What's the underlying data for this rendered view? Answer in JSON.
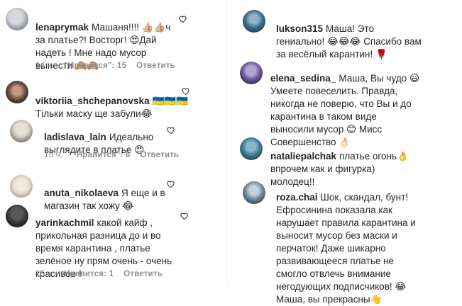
{
  "left": [
    {
      "username": "lenaprymak",
      "text": "Машаня!!!! 👍🏼👍🏼ч\nза платье?! Восторг! 😍Дай\nнадеть ! Мне надо мусор\nвынести 🙈🙈",
      "time": "14 ч.",
      "likes": "\"Нравится\": 15",
      "reply": "Ответить",
      "avatar_colors": [
        "#d8d8dc",
        "#8a8f99"
      ]
    },
    {
      "username": "viktoriia_shchepanovska",
      "text": "🇺🇦🇺🇦🇺🇦\nТільки маску ще забули😂",
      "time": "",
      "likes": "",
      "reply": "",
      "avatar_colors": [
        "#7b5a4a",
        "#2f2420"
      ]
    },
    {
      "username": "ladislava_lain",
      "text": "Идеально\nвыглядите в платье 😍",
      "time": "15 ч.",
      "likes": "\"Нравится\": 6",
      "reply": "Ответить",
      "avatar_colors": [
        "#c9c2b5",
        "#6f6a62"
      ]
    },
    {
      "username": "anuta_nikolaeva",
      "text": "Я еще и в\nмагазин так хожу 😂",
      "time": "",
      "likes": "",
      "reply": "",
      "avatar_colors": [
        "#e6d9cf",
        "#a58f80"
      ]
    },
    {
      "username": "yarinkachmil",
      "text": "какой кайф ,\nприкольная разница до и во\nвремя карантина , платье\nзелёное ну прям очень - очень\nкрасивое !",
      "time": "15 ч.",
      "likes": "Нравится: 1",
      "reply": "Ответить",
      "avatar_colors": [
        "#3a3a3a",
        "#111111"
      ]
    }
  ],
  "right": [
    {
      "username": "lukson315",
      "text": "Маша! Это\nгениально! 😂😂😂 Спасибо вам\nза весёлый карантин! 🌹",
      "avatar_colors": [
        "#3b6b88",
        "#1e3c52"
      ]
    },
    {
      "username": "elena_sedina_",
      "text": "Маша, Вы чудо 😃\nУмеете повеселить. Правда,\nникогда не поверю, что Вы и до\nкарантина в таком виде\nвыносили мусор 😊 Мисс\nСовершенство 👌🏻",
      "avatar_colors": [
        "#6b5a9a",
        "#2c2540"
      ]
    },
    {
      "username": "nataliepalchak",
      "text": "платье огонь👌\nвпрочем как и фигурка)\nмолодец!!",
      "avatar_colors": [
        "#3e7a8f",
        "#1f3a45"
      ]
    },
    {
      "username": "roza.chai",
      "text": "Шок, скандал, бунт!\nЕфросинина показала как\nнарушает правила карантина и\nвыносит мусор без маски и\nперчаток! Даже шикарно\nразвивающееся платье не\nсмогло отвлечь внимание\nнегодующих подписчиков! 😂\nМаша, вы прекрасны👋",
      "avatar_colors": [
        "#6f8899",
        "#2b3944"
      ]
    }
  ]
}
